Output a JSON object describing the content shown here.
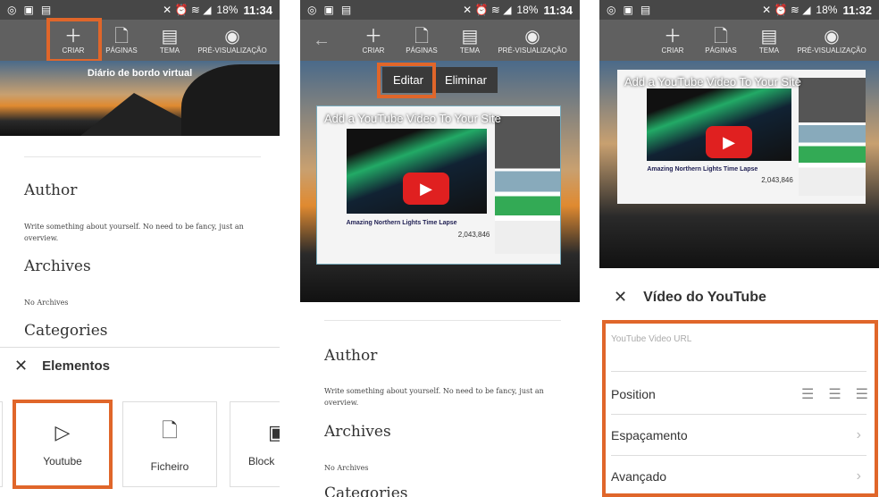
{
  "status_bar": {
    "battery": "18%",
    "times": [
      "11:34",
      "11:34",
      "11:32"
    ]
  },
  "toolbar": {
    "items": [
      {
        "label": "CRIAR",
        "icon": "plus-icon"
      },
      {
        "label": "PÁGINAS",
        "icon": "page-icon"
      },
      {
        "label": "TEMA",
        "icon": "layout-icon"
      },
      {
        "label": "PRÉ-VISUALIZAÇÃO",
        "icon": "eye-icon"
      }
    ]
  },
  "blog": {
    "title": "Diário de bordo virtual",
    "author_heading": "Author",
    "author_text": "Write something about yourself. No need to be fancy, just an overview.",
    "archives_heading": "Archives",
    "archives_text": "No Archives",
    "categories_heading": "Categories"
  },
  "elements_sheet": {
    "title": "Elementos",
    "tiles": [
      {
        "label": "Youtube",
        "icon": "youtube-icon"
      },
      {
        "label": "Ficheiro",
        "icon": "file-icon"
      },
      {
        "label": "Block",
        "icon": "block-icon"
      }
    ]
  },
  "popup": {
    "edit": "Editar",
    "delete": "Eliminar"
  },
  "video": {
    "title": "Add a YouTube Video To Your Site",
    "caption": "Amazing Northern Lights Time Lapse",
    "views": "2,043,846"
  },
  "youtube_panel": {
    "title": "Vídeo do YouTube",
    "url_placeholder": "YouTube Video URL",
    "position": "Position",
    "spacing": "Espaçamento",
    "advanced": "Avançado"
  },
  "colors": {
    "highlight": "#e0662a",
    "toolbar": "#606060",
    "status": "#474747"
  }
}
